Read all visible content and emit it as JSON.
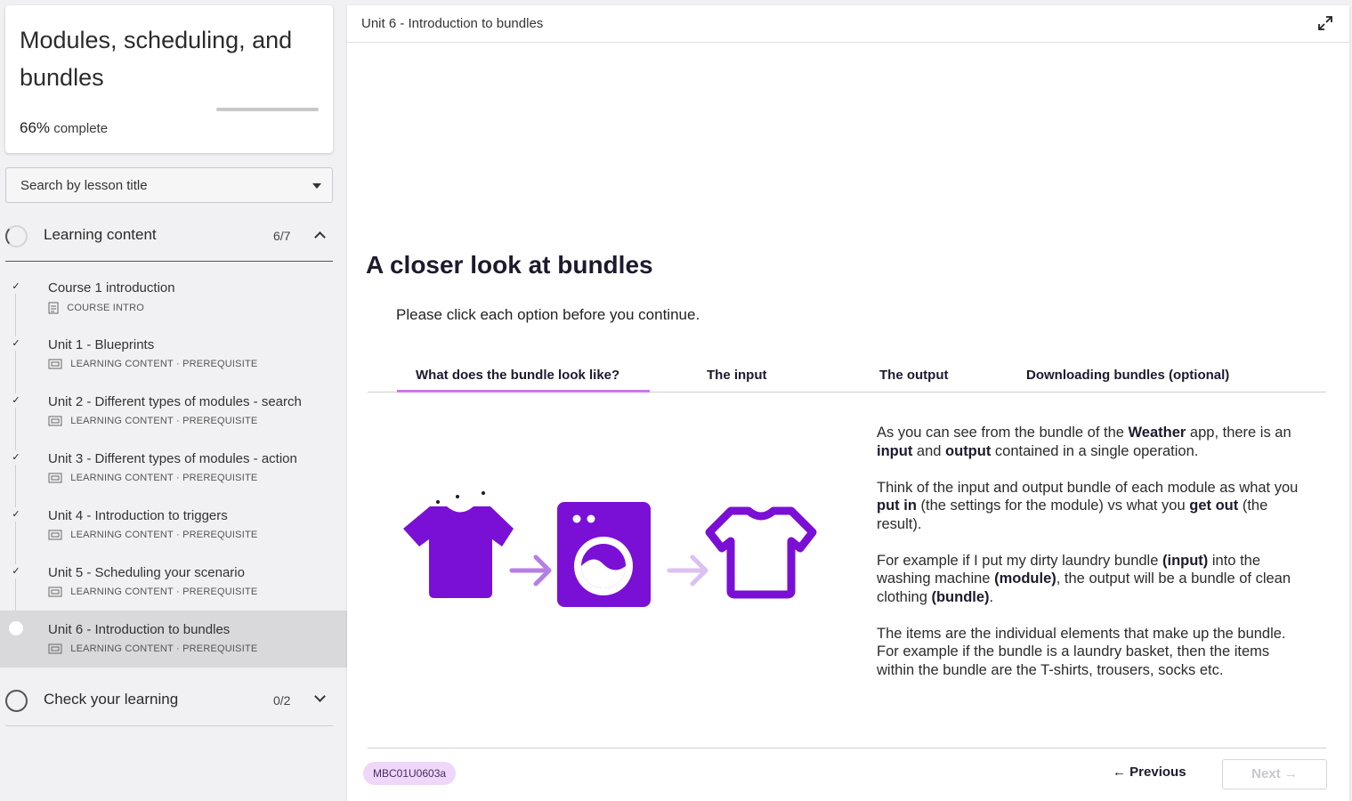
{
  "sidebar": {
    "course_title": "Modules, scheduling, and bundles",
    "progress_percent": "66%",
    "progress_suffix": "complete",
    "progress_value": 0.66,
    "search_placeholder": "Search by lesson title",
    "sections": [
      {
        "title": "Learning content",
        "count": "6/7",
        "expanded": true,
        "lessons": [
          {
            "name": "Course 1 introduction",
            "meta": "COURSE INTRO",
            "icon": "document-icon",
            "completed": true
          },
          {
            "name": "Unit 1 - Blueprints",
            "meta": "LEARNING CONTENT · PREREQUISITE",
            "icon": "slides-icon",
            "completed": true
          },
          {
            "name": "Unit 2 - Different types of modules - search",
            "meta": "LEARNING CONTENT · PREREQUISITE",
            "icon": "slides-icon",
            "completed": true
          },
          {
            "name": "Unit 3 - Different types of modules - action",
            "meta": "LEARNING CONTENT · PREREQUISITE",
            "icon": "slides-icon",
            "completed": true
          },
          {
            "name": "Unit 4 - Introduction to triggers",
            "meta": "LEARNING CONTENT · PREREQUISITE",
            "icon": "slides-icon",
            "completed": true
          },
          {
            "name": "Unit 5 - Scheduling your scenario",
            "meta": "LEARNING CONTENT · PREREQUISITE",
            "icon": "slides-icon",
            "completed": true
          },
          {
            "name": "Unit 6 - Introduction to bundles",
            "meta": "LEARNING CONTENT · PREREQUISITE",
            "icon": "slides-icon",
            "completed": false,
            "active": true
          }
        ]
      },
      {
        "title": "Check your learning",
        "count": "0/2",
        "expanded": false
      }
    ]
  },
  "main": {
    "topbar_title": "Unit 6 - Introduction to bundles",
    "heading": "A closer look at bundles",
    "instruction": "Please click each option before you continue.",
    "tabs": [
      {
        "label": "What does the bundle look like?",
        "active": true
      },
      {
        "label": "The input",
        "active": false
      },
      {
        "label": "The output",
        "active": false
      },
      {
        "label": "Downloading bundles (optional)",
        "active": false
      }
    ],
    "description": {
      "p1": {
        "a": "As you can see from the bundle of the ",
        "b1": "Weather",
        "c": " app, there is an ",
        "b2": "input",
        "d": " and ",
        "b3": "output",
        "e": " contained in a single operation."
      },
      "p2": {
        "a": "Think of the input and output bundle of each module as what you ",
        "b1": "put in",
        "c": " (the settings for the module) vs what you ",
        "b2": "get out",
        "d": " (the result)."
      },
      "p3": {
        "a": "For example if I put my dirty laundry bundle ",
        "b1": "(input)",
        "c": " into the washing machine ",
        "b2": "(module)",
        "d": ", the output will be a bundle of clean clothing ",
        "b3": "(bundle)",
        "e": "."
      },
      "p4": "The items are the individual elements that make up the bundle. For example if the bundle is a laundry basket, then the items within the bundle are the T-shirts, trousers, socks etc."
    },
    "footer": {
      "code": "MBC01U0603a",
      "previous_label": "Previous",
      "next_label": "Next"
    }
  },
  "colors": {
    "accent_purple": "#7a0fd6",
    "arrow_purple": "#b57de6",
    "arrow_light": "#dcc0f2",
    "tab_underline": "#c77ae8",
    "chip_bg": "#eed7f8"
  }
}
